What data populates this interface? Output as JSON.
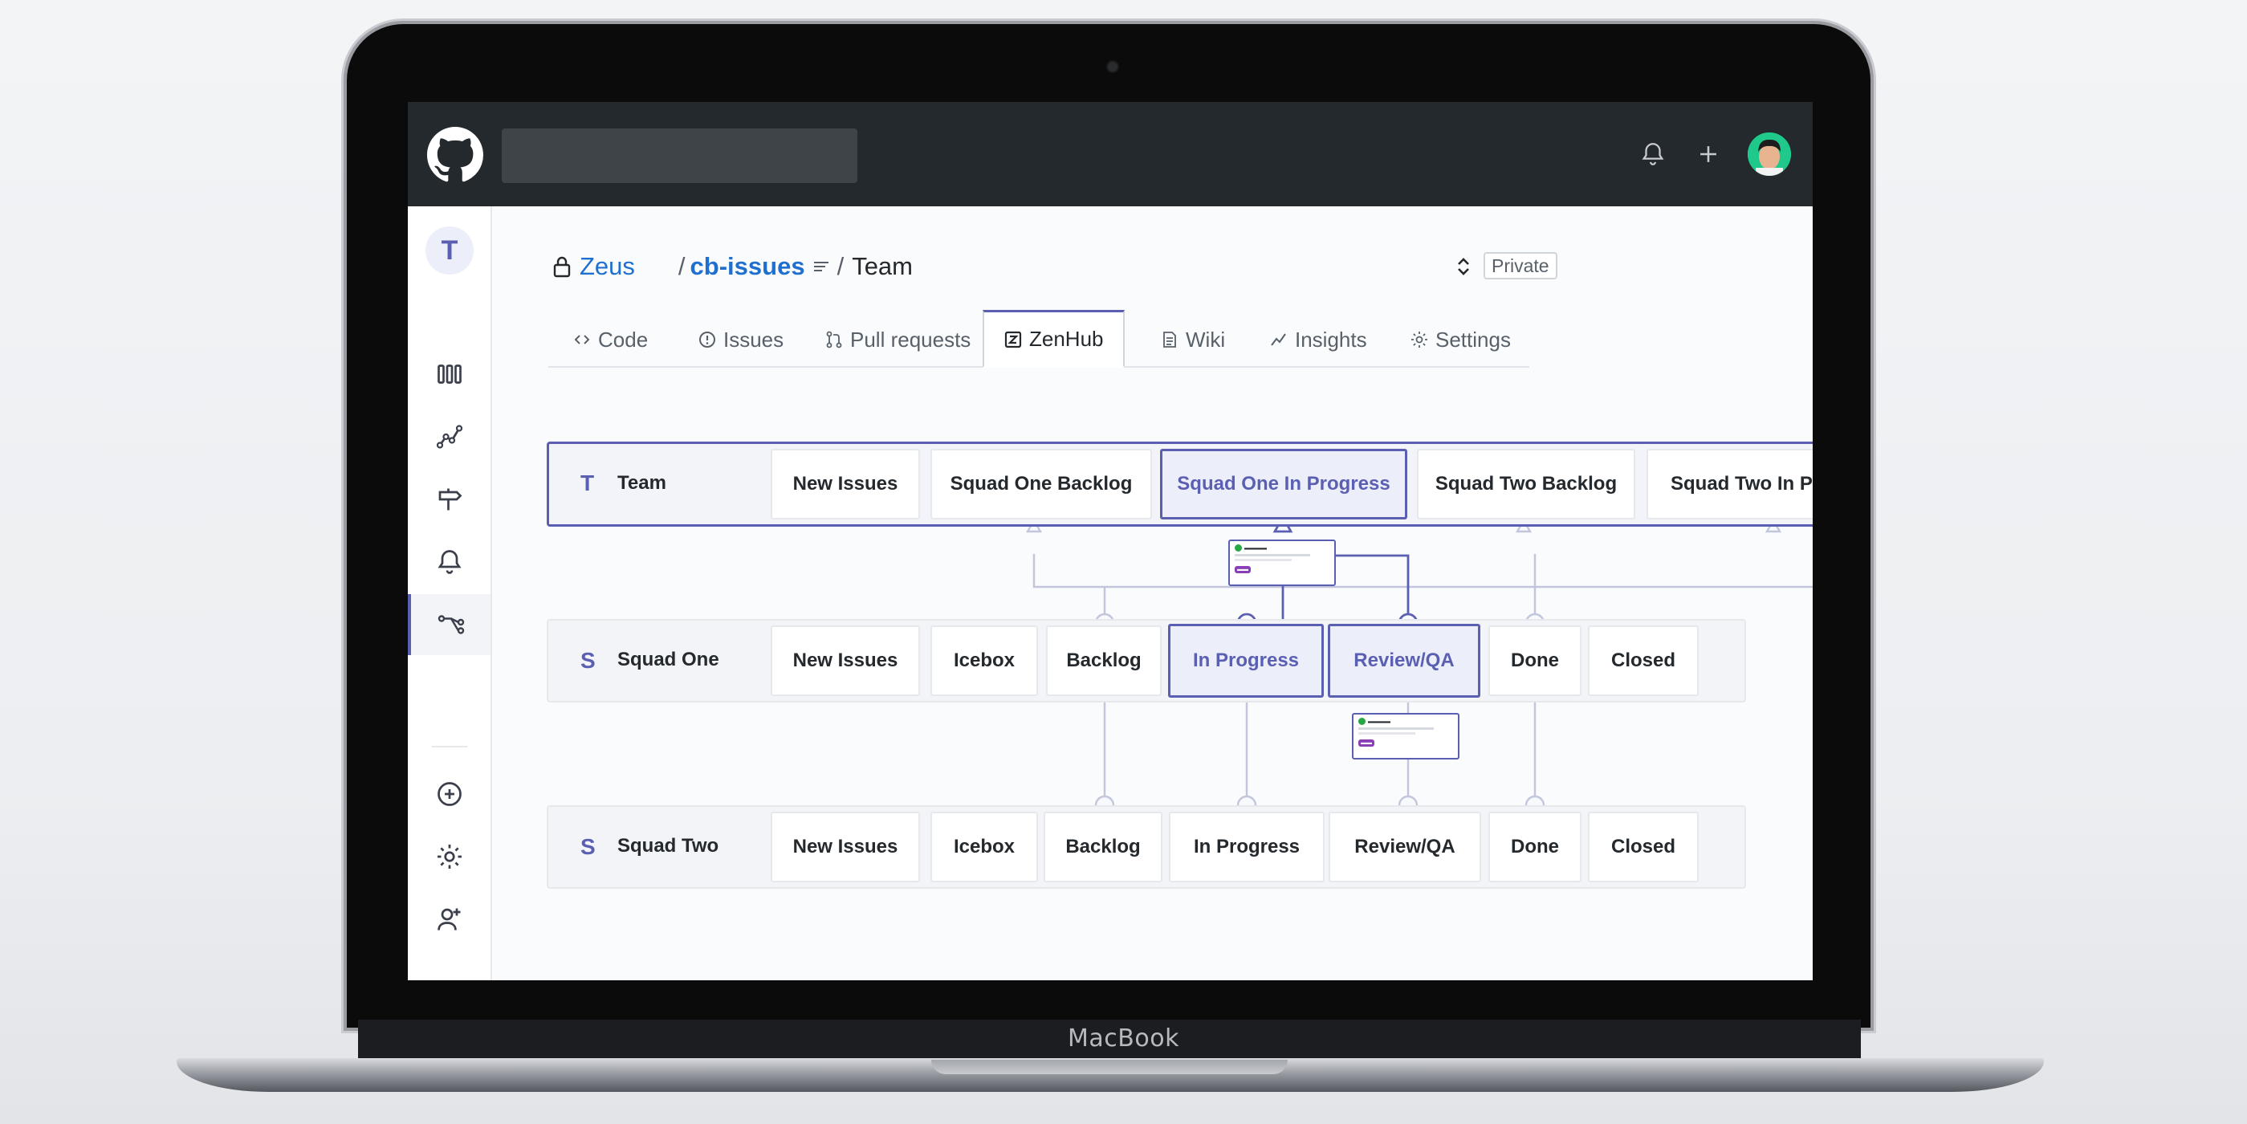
{
  "device": {
    "brand": "MacBook"
  },
  "header": {
    "logo_icon": "github-octocat-icon",
    "search_placeholder": "",
    "icons": [
      "bell-icon",
      "plus-icon"
    ]
  },
  "sidebar": {
    "avatar_letter": "T",
    "items": [
      "board-icon",
      "reports-icon",
      "roadmap-icon",
      "notifications-icon",
      "workspace-flow-icon",
      "add-icon",
      "settings-icon",
      "add-user-icon"
    ]
  },
  "repo": {
    "owner": "Zeus",
    "separator": "/",
    "name": "cb-issues",
    "board": "Team",
    "visibility": "Private"
  },
  "tabs": [
    {
      "label": "Code"
    },
    {
      "label": "Issues"
    },
    {
      "label": "Pull requests"
    },
    {
      "label": "ZenHub"
    },
    {
      "label": "Wiki"
    },
    {
      "label": "Insights"
    },
    {
      "label": "Settings"
    }
  ],
  "board": {
    "team": {
      "badge": "T",
      "label": "Team",
      "pipelines": [
        "New Issues",
        "Squad One Backlog",
        "Squad One In Progress",
        "Squad Two Backlog",
        "Squad Two In Pr"
      ]
    },
    "squad_one": {
      "badge": "S",
      "label": "Squad One",
      "pipelines": [
        "New Issues",
        "Icebox",
        "Backlog",
        "In Progress",
        "Review/QA",
        "Done",
        "Closed"
      ]
    },
    "squad_two": {
      "badge": "S",
      "label": "Squad Two",
      "pipelines": [
        "New Issues",
        "Icebox",
        "Backlog",
        "In Progress",
        "Review/QA",
        "Done",
        "Closed"
      ]
    }
  },
  "colors": {
    "accent": "#5b5fb2",
    "link": "#1e6fcf",
    "header": "#24292e"
  }
}
